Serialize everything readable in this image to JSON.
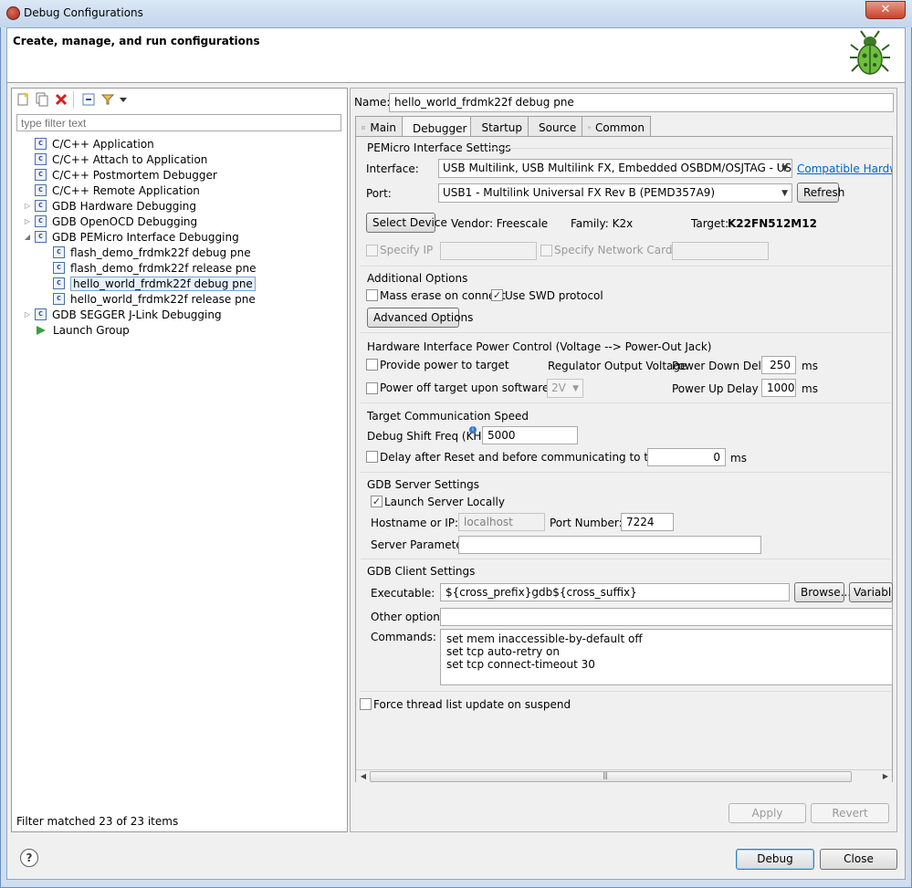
{
  "window": {
    "title": "Debug Configurations",
    "close_glyph": "✕",
    "header_title": "Create, manage, and run configurations"
  },
  "left": {
    "filter_placeholder": "type filter text",
    "tree": [
      {
        "label": "C/C++ Application",
        "icon": "c-config-icon",
        "indent": 0
      },
      {
        "label": "C/C++ Attach to Application",
        "icon": "c-config-icon",
        "indent": 0
      },
      {
        "label": "C/C++ Postmortem Debugger",
        "icon": "c-config-icon",
        "indent": 0
      },
      {
        "label": "C/C++ Remote Application",
        "icon": "c-config-icon",
        "indent": 0
      },
      {
        "label": "GDB Hardware Debugging",
        "icon": "c-config-icon",
        "indent": 0,
        "twisty": "▷"
      },
      {
        "label": "GDB OpenOCD Debugging",
        "icon": "c-config-icon",
        "indent": 0,
        "twisty": "▷"
      },
      {
        "label": "GDB PEMicro Interface Debugging",
        "icon": "c-config-icon",
        "indent": 0,
        "twisty": "◢"
      },
      {
        "label": "flash_demo_frdmk22f debug pne",
        "icon": "c-config-icon",
        "indent": 1
      },
      {
        "label": "flash_demo_frdmk22f release pne",
        "icon": "c-config-icon",
        "indent": 1
      },
      {
        "label": "hello_world_frdmk22f debug pne",
        "icon": "c-config-icon",
        "indent": 1,
        "selected": true
      },
      {
        "label": "hello_world_frdmk22f release pne",
        "icon": "c-config-icon",
        "indent": 1
      },
      {
        "label": "GDB SEGGER J-Link Debugging",
        "icon": "c-config-icon",
        "indent": 0,
        "twisty": "▷"
      },
      {
        "label": "Launch Group",
        "icon": "launch-icon",
        "indent": 0
      }
    ],
    "filter_status": "Filter matched 23 of 23 items"
  },
  "right": {
    "name_label": "Name:",
    "name_value": "hello_world_frdmk22f debug pne",
    "tabs": [
      "Main",
      "Debugger",
      "Startup",
      "Source",
      "Common"
    ],
    "active_tab": "Debugger",
    "pemicro": {
      "section": "PEMicro Interface Settings",
      "interface_label": "Interface:",
      "interface_value": "USB Multilink, USB Multilink FX, Embedded OSBDM/OSJTAG - USB Port",
      "compatible_link": "Compatible Hardware",
      "port_label": "Port:",
      "port_value": "USB1 - Multilink Universal FX Rev B (PEMD357A9)",
      "refresh": "Refresh",
      "select_device": "Select Device",
      "vendor": "Vendor:  Freescale",
      "family": "Family:  K2x",
      "target_label": "Target:",
      "target_value": "K22FN512M12",
      "specify_ip": "Specify IP",
      "specify_nic": "Specify Network Card IP"
    },
    "additional": {
      "section": "Additional Options",
      "mass_erase": "Mass erase on connect",
      "use_swd": "Use SWD protocol",
      "advanced": "Advanced Options"
    },
    "power": {
      "section": "Hardware Interface Power Control (Voltage --> Power-Out Jack)",
      "provide_power": "Provide power to target",
      "regulator": "Regulator Output Voltage",
      "power_down_delay": "Power Down Delay",
      "power_down_value": "250",
      "ms1": "ms",
      "power_off": "Power off target upon software exit",
      "voltage": "2V",
      "power_up_delay": "Power Up Delay",
      "power_up_value": "1000",
      "ms2": "ms"
    },
    "speed": {
      "section": "Target Communication Speed",
      "shift_label": "Debug Shift Freq (KHz)",
      "shift_value": "5000",
      "delay_label": "Delay after Reset and before communicating to target for",
      "delay_value": "0",
      "ms": "ms"
    },
    "server": {
      "section": "GDB Server Settings",
      "launch_local": "Launch Server Locally",
      "hostname_label": "Hostname or IP:",
      "hostname_value": "localhost",
      "port_label": "Port Number:",
      "port_value": "7224",
      "params_label": "Server Parameters:"
    },
    "client": {
      "section": "GDB Client Settings",
      "exec_label": "Executable:",
      "exec_value": "${cross_prefix}gdb${cross_suffix}",
      "browse": "Browse...",
      "variables": "Variables...",
      "other_label": "Other options:",
      "commands_label": "Commands:",
      "commands": [
        "set mem inaccessible-by-default off",
        "set tcp auto-retry on",
        "set tcp connect-timeout 30"
      ]
    },
    "force_update": "Force thread list update on suspend",
    "scroll_grip": "|||",
    "scroll_left": "◀",
    "scroll_right": "▶",
    "apply": "Apply",
    "revert": "Revert"
  },
  "footer": {
    "help_glyph": "?",
    "debug": "Debug",
    "close": "Close"
  }
}
